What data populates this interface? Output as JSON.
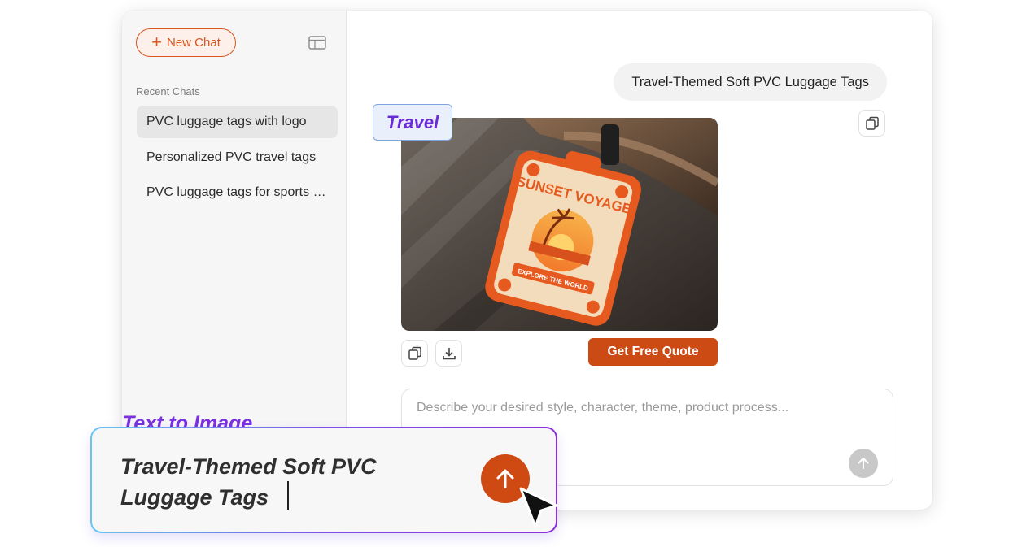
{
  "sidebar": {
    "new_chat_label": "New Chat",
    "recent_label": "Recent Chats",
    "items": [
      {
        "label": "PVC luggage tags with logo"
      },
      {
        "label": "Personalized PVC travel tags"
      },
      {
        "label": "PVC luggage tags for sports b..."
      }
    ]
  },
  "main": {
    "user_message": "Travel-Themed Soft PVC Luggage Tags",
    "tag_label": "Travel",
    "image": {
      "headline": "SUNSET VOYAGE",
      "subline": "EXPLORE THE WORLD"
    },
    "quote_button": "Get Free Quote",
    "prompt_placeholder": "Describe your desired style, character, theme, product process..."
  },
  "overlay": {
    "title": "Text to Image",
    "prompt_line1": "Travel-Themed Soft PVC",
    "prompt_line2": "Luggage Tags"
  },
  "colors": {
    "accent": "#cc4b14",
    "tag_text": "#6c2bd9",
    "gradient_start": "#66c6f2",
    "gradient_end": "#8a2fd6"
  },
  "icons": [
    "plus-icon",
    "sidebar-toggle-icon",
    "copy-icon",
    "download-icon",
    "arrow-up-icon",
    "mouse-cursor-icon"
  ]
}
